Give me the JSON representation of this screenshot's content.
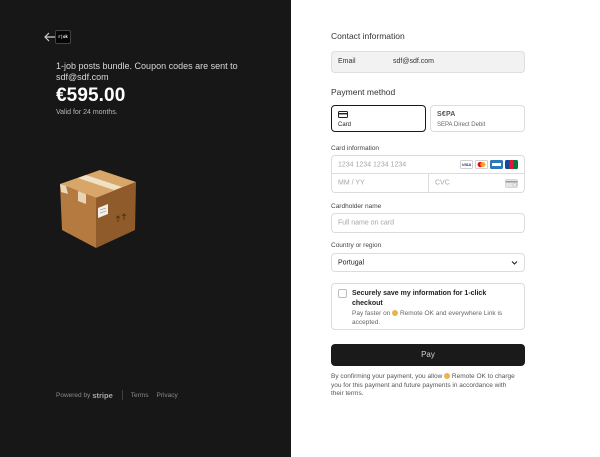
{
  "product": {
    "logo_text": "r|ok",
    "description": "1-job posts bundle. Coupon codes are sent to sdf@sdf.com",
    "price": "€595.00",
    "validity": "Valid for 24 months."
  },
  "footer": {
    "powered_by": "Powered by",
    "stripe": "stripe",
    "terms": "Terms",
    "privacy": "Privacy"
  },
  "contact": {
    "title": "Contact information",
    "email_label": "Email",
    "email_value": "sdf@sdf.com"
  },
  "payment": {
    "title": "Payment method",
    "methods": [
      {
        "label": "Card",
        "icon": "card-icon",
        "selected": true
      },
      {
        "label": "SEPA Direct Debit",
        "logo": "S€PA",
        "selected": false
      }
    ]
  },
  "card": {
    "label": "Card information",
    "number_placeholder": "1234 1234 1234 1234",
    "expiry_placeholder": "MM / YY",
    "cvc_placeholder": "CVC",
    "brand_visa": "VISA",
    "brands": [
      "visa-icon",
      "mastercard-icon",
      "amex-icon",
      "jcb-icon"
    ]
  },
  "holder": {
    "label": "Cardholder name",
    "placeholder": "Full name on card"
  },
  "country": {
    "label": "Country or region",
    "value": "Portugal"
  },
  "save": {
    "title": "Securely save my information for 1-click checkout",
    "desc_prefix": "Pay faster on",
    "desc_suffix": "Remote OK and everywhere Link is accepted."
  },
  "pay_button": "Pay",
  "terms": {
    "prefix": "By confirming your payment, you allow",
    "suffix": "Remote OK to charge you for this payment and future payments in accordance with their terms."
  }
}
